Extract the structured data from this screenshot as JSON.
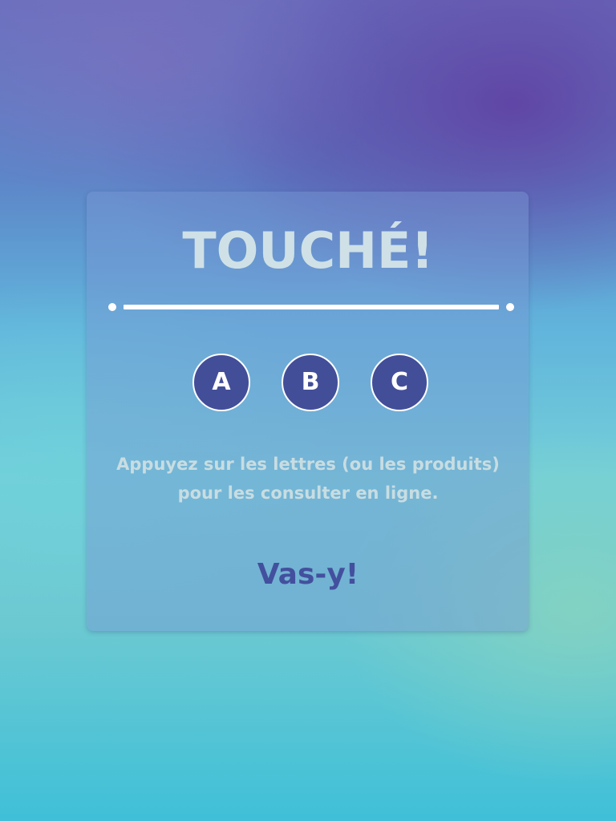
{
  "popup": {
    "title": "TOUCHÉ!",
    "letters": [
      "A",
      "B",
      "C"
    ],
    "instructions_line1": "Appuyez sur les lettres (ou les produits)",
    "instructions_line2": "pour les consulter en ligne.",
    "go_label": "Vas-y!"
  },
  "colors": {
    "title_text": "#cfe1e6",
    "letter_circle_fill": "#434e99",
    "letter_circle_border": "#ffffff",
    "instruction_text": "#c8dde2",
    "go_text": "#43509e"
  }
}
